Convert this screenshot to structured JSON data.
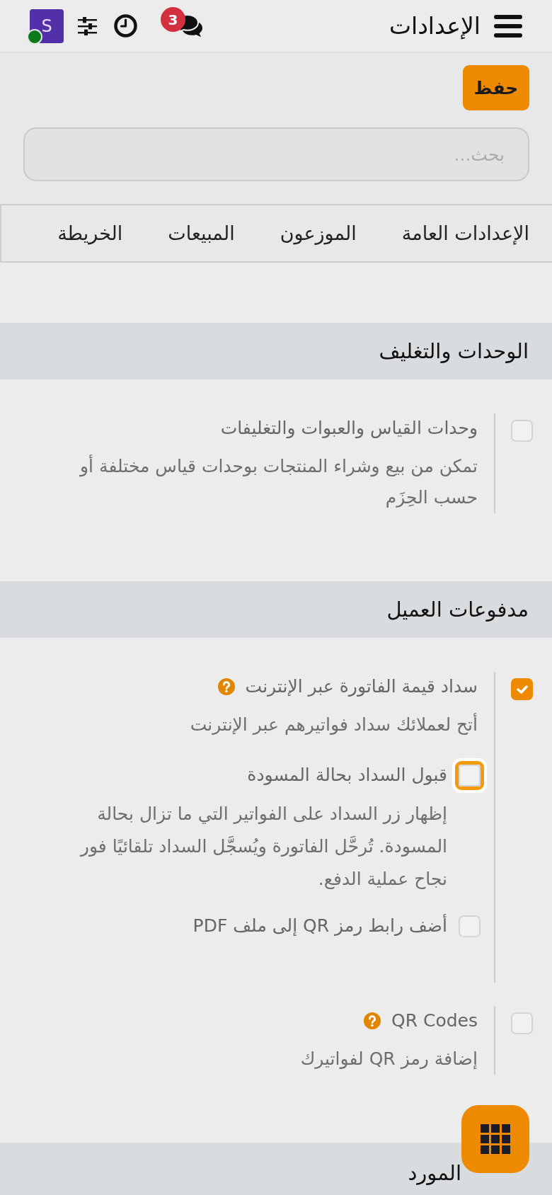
{
  "top_bar": {
    "title": "الإعدادات",
    "notification_count": "3",
    "avatar_initial": "S",
    "online": true
  },
  "save_button": "حفظ",
  "search": {
    "placeholder": "بحث..."
  },
  "tabs": [
    {
      "label": "الإعدادات العامة",
      "selected": false
    },
    {
      "label": "الموزعون",
      "selected": false
    },
    {
      "label": "المبيعات",
      "selected": false
    },
    {
      "label": "الخريطة",
      "selected": false
    }
  ],
  "sections": [
    {
      "title": "الوحدات والتغليف",
      "items": [
        {
          "label": "وحدات القياس والعبوات والتغليفات",
          "help": false,
          "checked": false,
          "focused": false,
          "description": "تمكن من بيع وشراء المنتجات بوحدات قياس مختلفة أو حسب الحِزَم"
        }
      ]
    },
    {
      "title": "مدفوعات العميل",
      "items": [
        {
          "label": "سداد قيمة الفاتورة عبر الإنترنت",
          "help": true,
          "checked": true,
          "focused": false,
          "description": "أتح لعملائك سداد فواتيرهم عبر الإنترنت",
          "children": [
            {
              "label": "قبول السداد بحالة المسودة",
              "checked": false,
              "focused": true,
              "description": "إظهار زر السداد على الفواتير التي ما تزال بحالة المسودة. تُرحَّل الفاتورة ويُسجَّل السداد تلقائيًا فور نجاح عملية الدفع."
            },
            {
              "label": "أضف رابط رمز QR إلى ملف PDF",
              "checked": false,
              "focused": false
            }
          ]
        },
        {
          "label": "QR Codes",
          "help": true,
          "checked": false,
          "focused": false,
          "description": "إضافة رمز QR لفواتيرك"
        }
      ]
    },
    {
      "title": "المورد"
    }
  ]
}
